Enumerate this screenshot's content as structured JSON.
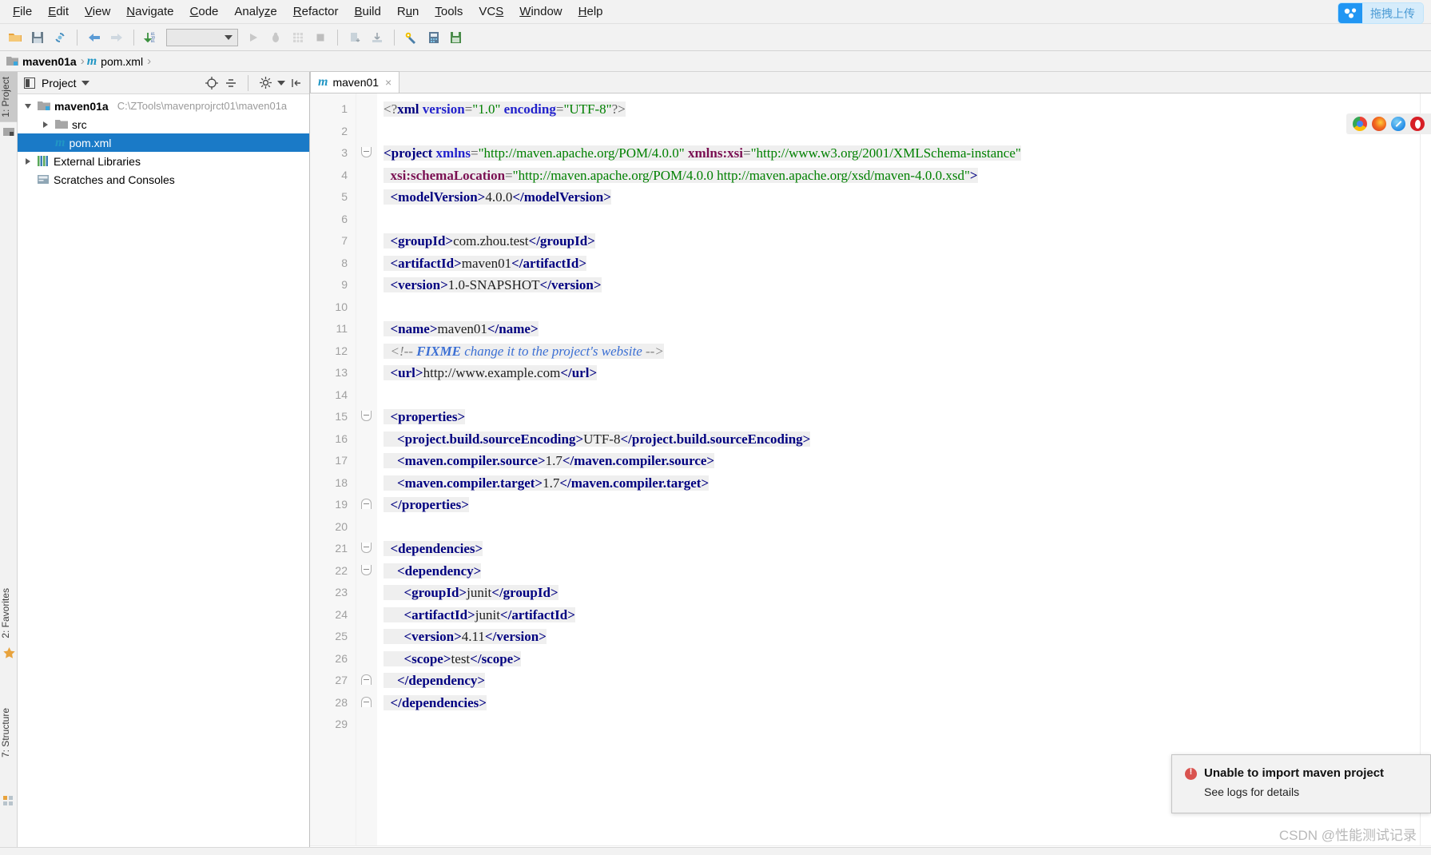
{
  "app": {
    "menu": [
      {
        "label": "File",
        "mnemonic": "F"
      },
      {
        "label": "Edit",
        "mnemonic": "E"
      },
      {
        "label": "View",
        "mnemonic": "V"
      },
      {
        "label": "Navigate",
        "mnemonic": "N"
      },
      {
        "label": "Code",
        "mnemonic": "C"
      },
      {
        "label": "Analyze",
        "mnemonic": "z"
      },
      {
        "label": "Refactor",
        "mnemonic": "R"
      },
      {
        "label": "Build",
        "mnemonic": "B"
      },
      {
        "label": "Run",
        "mnemonic": "u"
      },
      {
        "label": "Tools",
        "mnemonic": "T"
      },
      {
        "label": "VCS",
        "mnemonic": "S"
      },
      {
        "label": "Window",
        "mnemonic": "W"
      },
      {
        "label": "Help",
        "mnemonic": "H"
      }
    ],
    "upload_badge": "拖拽上传"
  },
  "toolbar": {
    "open_label": "open-project",
    "save_label": "save-all",
    "sync_label": "synchronize",
    "back_label": "navigate-back",
    "forward_label": "navigate-forward",
    "sort_label": "compile",
    "run_config_value": "",
    "run_label": "run",
    "debug_label": "debug",
    "coverage_label": "run-with-coverage",
    "stop_label": "stop",
    "update_label": "update-project",
    "commit_label": "commit",
    "settings_label": "settings",
    "structure_label": "project-structure",
    "save_db_label": "save-db"
  },
  "breadcrumb": {
    "items": [
      {
        "label": "maven01a",
        "bold": true,
        "icon": "folder-icon"
      },
      {
        "label": "pom.xml",
        "bold": false,
        "icon": "maven-m-icon"
      }
    ]
  },
  "rail": {
    "left_tabs": [
      {
        "label": "1: Project",
        "active": true
      },
      {
        "label": "2: Favorites",
        "active": false
      },
      {
        "label": "7: Structure",
        "active": false
      }
    ]
  },
  "project_panel": {
    "title": "Project",
    "tree": [
      {
        "label": "maven01a",
        "path": "C:\\ZTools\\mavenprojrct01\\maven01a",
        "depth": 0,
        "expanded": true,
        "bold": true,
        "icon": "module-folder-icon",
        "selected": false
      },
      {
        "label": "src",
        "path": "",
        "depth": 1,
        "expanded": false,
        "bold": false,
        "icon": "folder-icon",
        "selected": false
      },
      {
        "label": "pom.xml",
        "path": "",
        "depth": 1,
        "expanded": null,
        "bold": false,
        "icon": "maven-m-icon",
        "selected": true
      },
      {
        "label": "External Libraries",
        "path": "",
        "depth": 0,
        "expanded": false,
        "bold": false,
        "icon": "libraries-icon",
        "selected": false
      },
      {
        "label": "Scratches and Consoles",
        "path": "",
        "depth": 0,
        "expanded": null,
        "bold": false,
        "icon": "scratches-icon",
        "selected": false
      }
    ]
  },
  "editor": {
    "tabs": [
      {
        "label": "maven01",
        "icon": "maven-m-icon",
        "close": "×",
        "active": true
      }
    ],
    "lines": [
      {
        "n": 1,
        "fold": null,
        "segs": [
          {
            "t": "<?",
            "c": "pi"
          },
          {
            "t": "xml",
            "c": "tag"
          },
          {
            "t": " ",
            "c": "txt"
          },
          {
            "t": "version",
            "c": "attr"
          },
          {
            "t": "=",
            "c": "pi"
          },
          {
            "t": "\"1.0\"",
            "c": "str"
          },
          {
            "t": " ",
            "c": "txt"
          },
          {
            "t": "encoding",
            "c": "attr"
          },
          {
            "t": "=",
            "c": "pi"
          },
          {
            "t": "\"UTF-8\"",
            "c": "str"
          },
          {
            "t": "?>",
            "c": "pi"
          }
        ]
      },
      {
        "n": 2,
        "fold": null,
        "segs": []
      },
      {
        "n": 3,
        "fold": "down",
        "segs": [
          {
            "t": "<project",
            "c": "tag"
          },
          {
            "t": " ",
            "c": "txt"
          },
          {
            "t": "xmlns",
            "c": "attr"
          },
          {
            "t": "=",
            "c": "pi"
          },
          {
            "t": "\"http://maven.apache.org/POM/4.0.0\"",
            "c": "str"
          },
          {
            "t": " ",
            "c": "txt"
          },
          {
            "t": "xmlns:xsi",
            "c": "attr2"
          },
          {
            "t": "=",
            "c": "pi"
          },
          {
            "t": "\"http://www.w3.org/2001/XMLSchema-instance\"",
            "c": "str"
          }
        ]
      },
      {
        "n": 4,
        "fold": null,
        "segs": [
          {
            "t": "  ",
            "c": "txt"
          },
          {
            "t": "xsi:schemaLocation",
            "c": "attr2"
          },
          {
            "t": "=",
            "c": "pi"
          },
          {
            "t": "\"http://maven.apache.org/POM/4.0.0 http://maven.apache.org/xsd/maven-4.0.0.xsd\"",
            "c": "str"
          },
          {
            "t": ">",
            "c": "tag"
          }
        ]
      },
      {
        "n": 5,
        "fold": null,
        "segs": [
          {
            "t": "  ",
            "c": "txt"
          },
          {
            "t": "<modelVersion>",
            "c": "tag"
          },
          {
            "t": "4.0.0",
            "c": "txt"
          },
          {
            "t": "</modelVersion>",
            "c": "tag"
          }
        ]
      },
      {
        "n": 6,
        "fold": null,
        "segs": []
      },
      {
        "n": 7,
        "fold": null,
        "segs": [
          {
            "t": "  ",
            "c": "txt"
          },
          {
            "t": "<groupId>",
            "c": "tag"
          },
          {
            "t": "com.zhou.test",
            "c": "txt"
          },
          {
            "t": "</groupId>",
            "c": "tag"
          }
        ]
      },
      {
        "n": 8,
        "fold": null,
        "segs": [
          {
            "t": "  ",
            "c": "txt"
          },
          {
            "t": "<artifactId>",
            "c": "tag"
          },
          {
            "t": "maven01",
            "c": "txt"
          },
          {
            "t": "</artifactId>",
            "c": "tag"
          }
        ]
      },
      {
        "n": 9,
        "fold": null,
        "segs": [
          {
            "t": "  ",
            "c": "txt"
          },
          {
            "t": "<version>",
            "c": "tag"
          },
          {
            "t": "1.0-SNAPSHOT",
            "c": "txt"
          },
          {
            "t": "</version>",
            "c": "tag"
          }
        ]
      },
      {
        "n": 10,
        "fold": null,
        "segs": []
      },
      {
        "n": 11,
        "fold": null,
        "segs": [
          {
            "t": "  ",
            "c": "txt"
          },
          {
            "t": "<name>",
            "c": "tag"
          },
          {
            "t": "maven01",
            "c": "txt"
          },
          {
            "t": "</name>",
            "c": "tag"
          }
        ]
      },
      {
        "n": 12,
        "fold": null,
        "segs": [
          {
            "t": "  ",
            "c": "txt"
          },
          {
            "t": "<!-- ",
            "c": "cmt"
          },
          {
            "t": "FIXME",
            "c": "cmt-b"
          },
          {
            "t": " change it to the project's website ",
            "c": "cmt-i"
          },
          {
            "t": "-->",
            "c": "cmt"
          }
        ]
      },
      {
        "n": 13,
        "fold": null,
        "segs": [
          {
            "t": "  ",
            "c": "txt"
          },
          {
            "t": "<url>",
            "c": "tag"
          },
          {
            "t": "http://www.example.com",
            "c": "txt"
          },
          {
            "t": "</url>",
            "c": "tag"
          }
        ]
      },
      {
        "n": 14,
        "fold": null,
        "segs": []
      },
      {
        "n": 15,
        "fold": "down",
        "segs": [
          {
            "t": "  ",
            "c": "txt"
          },
          {
            "t": "<properties>",
            "c": "tag"
          }
        ]
      },
      {
        "n": 16,
        "fold": null,
        "segs": [
          {
            "t": "    ",
            "c": "txt"
          },
          {
            "t": "<project.build.sourceEncoding>",
            "c": "tag"
          },
          {
            "t": "UTF-8",
            "c": "txt"
          },
          {
            "t": "</project.build.sourceEncoding>",
            "c": "tag"
          }
        ]
      },
      {
        "n": 17,
        "fold": null,
        "segs": [
          {
            "t": "    ",
            "c": "txt"
          },
          {
            "t": "<maven.compiler.source>",
            "c": "tag"
          },
          {
            "t": "1.7",
            "c": "txt"
          },
          {
            "t": "</maven.compiler.source>",
            "c": "tag"
          }
        ]
      },
      {
        "n": 18,
        "fold": null,
        "segs": [
          {
            "t": "    ",
            "c": "txt"
          },
          {
            "t": "<maven.compiler.target>",
            "c": "tag"
          },
          {
            "t": "1.7",
            "c": "txt"
          },
          {
            "t": "</maven.compiler.target>",
            "c": "tag"
          }
        ]
      },
      {
        "n": 19,
        "fold": "up",
        "segs": [
          {
            "t": "  ",
            "c": "txt"
          },
          {
            "t": "</properties>",
            "c": "tag"
          }
        ]
      },
      {
        "n": 20,
        "fold": null,
        "segs": []
      },
      {
        "n": 21,
        "fold": "down",
        "segs": [
          {
            "t": "  ",
            "c": "txt"
          },
          {
            "t": "<dependencies>",
            "c": "tag"
          }
        ]
      },
      {
        "n": 22,
        "fold": "down",
        "segs": [
          {
            "t": "    ",
            "c": "txt"
          },
          {
            "t": "<dependency>",
            "c": "tag"
          }
        ]
      },
      {
        "n": 23,
        "fold": null,
        "segs": [
          {
            "t": "      ",
            "c": "txt"
          },
          {
            "t": "<groupId>",
            "c": "tag"
          },
          {
            "t": "junit",
            "c": "txt"
          },
          {
            "t": "</groupId>",
            "c": "tag"
          }
        ]
      },
      {
        "n": 24,
        "fold": null,
        "segs": [
          {
            "t": "      ",
            "c": "txt"
          },
          {
            "t": "<artifactId>",
            "c": "tag"
          },
          {
            "t": "junit",
            "c": "txt"
          },
          {
            "t": "</artifactId>",
            "c": "tag"
          }
        ]
      },
      {
        "n": 25,
        "fold": null,
        "segs": [
          {
            "t": "      ",
            "c": "txt"
          },
          {
            "t": "<version>",
            "c": "tag"
          },
          {
            "t": "4.11",
            "c": "txt"
          },
          {
            "t": "</version>",
            "c": "tag"
          }
        ]
      },
      {
        "n": 26,
        "fold": null,
        "segs": [
          {
            "t": "      ",
            "c": "txt"
          },
          {
            "t": "<scope>",
            "c": "tag"
          },
          {
            "t": "test",
            "c": "txt"
          },
          {
            "t": "</scope>",
            "c": "tag"
          }
        ]
      },
      {
        "n": 27,
        "fold": "up",
        "segs": [
          {
            "t": "    ",
            "c": "txt"
          },
          {
            "t": "</dependency>",
            "c": "tag"
          }
        ]
      },
      {
        "n": 28,
        "fold": "up",
        "segs": [
          {
            "t": "  ",
            "c": "txt"
          },
          {
            "t": "</dependencies>",
            "c": "tag"
          }
        ]
      },
      {
        "n": 29,
        "fold": null,
        "segs": []
      }
    ]
  },
  "browsers": [
    {
      "name": "chrome-icon",
      "color": "#4caf50"
    },
    {
      "name": "firefox-icon",
      "color": "#e8641c"
    },
    {
      "name": "safari-icon",
      "color": "#2196f3"
    },
    {
      "name": "opera-icon",
      "color": "#d71f26"
    }
  ],
  "notification": {
    "title": "Unable to import maven project",
    "subtitle": "See logs for details",
    "icon": "error-icon",
    "color": "#d9534f"
  },
  "watermark": "CSDN @性能测试记录"
}
